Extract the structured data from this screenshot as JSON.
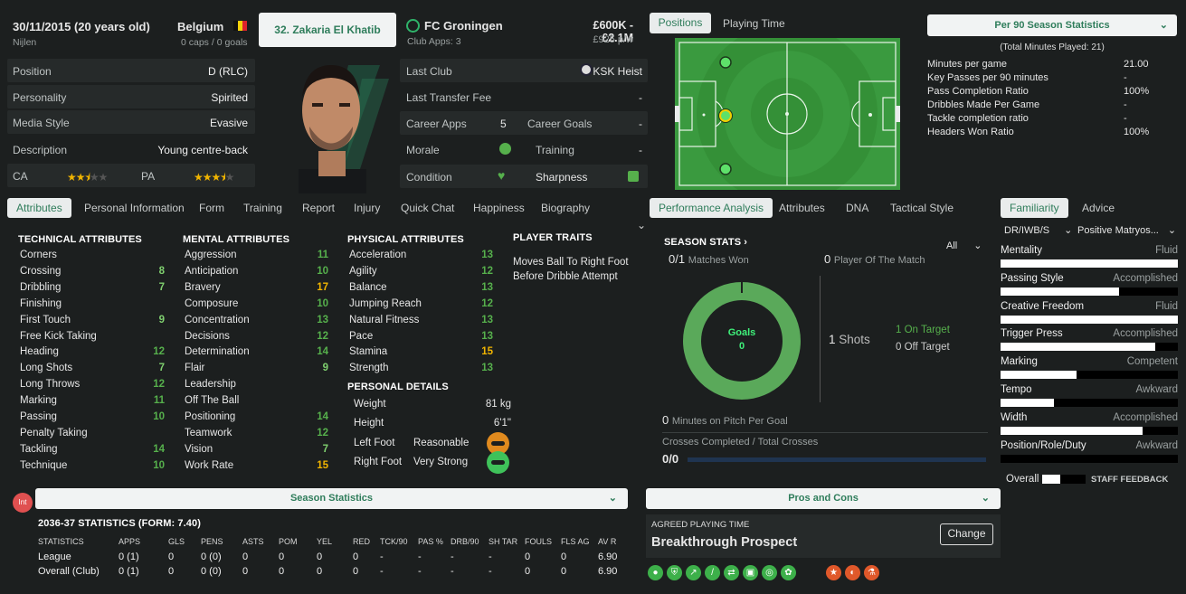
{
  "header": {
    "dob": "30/11/2015 (20 years old)",
    "city": "Nijlen",
    "nation": "Belgium",
    "caps": "0 caps / 0 goals",
    "player_button": "32. Zakaria El Khatib",
    "club": "FC Groningen",
    "club_apps": "Club Apps: 3",
    "value": "£600K - £2.1M",
    "wage": "£925 p/w"
  },
  "info": [
    {
      "label": "Position",
      "value": "D (RLC)"
    },
    {
      "label": "Personality",
      "value": "Spirited"
    },
    {
      "label": "Media Style",
      "value": "Evasive"
    },
    {
      "label": "Description",
      "value": "Young centre-back"
    }
  ],
  "ability": {
    "ca_label": "CA",
    "pa_label": "PA",
    "ca_stars": 2.5,
    "pa_stars": 3.5
  },
  "club_info": {
    "last_club_label": "Last Club",
    "last_club": "KSK Heist",
    "last_fee_label": "Last Transfer Fee",
    "last_fee": "-",
    "career_apps_label": "Career Apps",
    "career_apps": "5",
    "career_goals_label": "Career Goals",
    "career_goals": "-",
    "morale_label": "Morale",
    "training_label": "Training",
    "training": "-",
    "condition_label": "Condition",
    "sharpness_label": "Sharpness"
  },
  "right_tabs": {
    "positions": "Positions",
    "playing_time": "Playing Time"
  },
  "per90": {
    "dropdown": "Per 90 Season Statistics",
    "total": "(Total Minutes Played: 21)",
    "rows": [
      {
        "label": "Minutes per game",
        "value": "21.00"
      },
      {
        "label": "Key Passes per 90 minutes",
        "value": "-"
      },
      {
        "label": "Pass Completion Ratio",
        "value": "100%"
      },
      {
        "label": "Dribbles Made Per Game",
        "value": "-"
      },
      {
        "label": "Tackle completion ratio",
        "value": "-"
      },
      {
        "label": "Headers Won Ratio",
        "value": "100%"
      }
    ]
  },
  "tabs": [
    "Attributes",
    "Personal Information",
    "Form",
    "Training",
    "Report",
    "Injury",
    "Quick Chat",
    "Happiness",
    "Biography"
  ],
  "perf_tabs": [
    "Performance Analysis",
    "Attributes",
    "DNA",
    "Tactical Style"
  ],
  "fam_tabs": [
    "Familiarity",
    "Advice"
  ],
  "technical": {
    "title": "TECHNICAL ATTRIBUTES",
    "items": [
      {
        "n": "Corners",
        "v": ""
      },
      {
        "n": "Crossing",
        "v": "8"
      },
      {
        "n": "Dribbling",
        "v": "7"
      },
      {
        "n": "Finishing",
        "v": ""
      },
      {
        "n": "First Touch",
        "v": "9"
      },
      {
        "n": "Free Kick Taking",
        "v": ""
      },
      {
        "n": "Heading",
        "v": "12"
      },
      {
        "n": "Long Shots",
        "v": "7"
      },
      {
        "n": "Long Throws",
        "v": "12"
      },
      {
        "n": "Marking",
        "v": "11"
      },
      {
        "n": "Passing",
        "v": "10"
      },
      {
        "n": "Penalty Taking",
        "v": ""
      },
      {
        "n": "Tackling",
        "v": "14"
      },
      {
        "n": "Technique",
        "v": "10"
      }
    ]
  },
  "mental": {
    "title": "MENTAL ATTRIBUTES",
    "items": [
      {
        "n": "Aggression",
        "v": "11"
      },
      {
        "n": "Anticipation",
        "v": "10"
      },
      {
        "n": "Bravery",
        "v": "17"
      },
      {
        "n": "Composure",
        "v": "10"
      },
      {
        "n": "Concentration",
        "v": "13"
      },
      {
        "n": "Decisions",
        "v": "12"
      },
      {
        "n": "Determination",
        "v": "14"
      },
      {
        "n": "Flair",
        "v": "9"
      },
      {
        "n": "Leadership",
        "v": ""
      },
      {
        "n": "Off The Ball",
        "v": ""
      },
      {
        "n": "Positioning",
        "v": "14"
      },
      {
        "n": "Teamwork",
        "v": "12"
      },
      {
        "n": "Vision",
        "v": "7"
      },
      {
        "n": "Work Rate",
        "v": "15"
      }
    ]
  },
  "physical": {
    "title": "PHYSICAL ATTRIBUTES",
    "items": [
      {
        "n": "Acceleration",
        "v": "13"
      },
      {
        "n": "Agility",
        "v": "12"
      },
      {
        "n": "Balance",
        "v": "13"
      },
      {
        "n": "Jumping Reach",
        "v": "12"
      },
      {
        "n": "Natural Fitness",
        "v": "13"
      },
      {
        "n": "Pace",
        "v": "13"
      },
      {
        "n": "Stamina",
        "v": "15"
      },
      {
        "n": "Strength",
        "v": "13"
      }
    ]
  },
  "traits": {
    "title": "PLAYER TRAITS",
    "text1": "Moves Ball To Right Foot",
    "text2": "Before Dribble Attempt"
  },
  "personal": {
    "title": "PERSONAL DETAILS",
    "weight_label": "Weight",
    "weight": "81 kg",
    "height_label": "Height",
    "height": "6'1\"",
    "left_label": "Left Foot",
    "left": "Reasonable",
    "right_label": "Right Foot",
    "right": "Very Strong"
  },
  "season_stats": {
    "title": "SEASON STATS",
    "filter": "All",
    "matches_won": "0",
    "matches_total": "/1",
    "matches_label": "Matches Won",
    "potm": "0",
    "potm_label": "Player Of The Match",
    "goals_label": "Goals",
    "goals": "0",
    "shots": "1",
    "shots_label": "Shots",
    "on_target": "1",
    "on_target_label": "On Target",
    "off_target": "0",
    "off_target_label": "Off Target",
    "mins_per_goal": "0",
    "mins_label": "Minutes on Pitch Per Goal",
    "crosses_label": "Crosses Completed / Total Crosses",
    "crosses": "0/0"
  },
  "familiarity": {
    "role": "DR/IWB/S",
    "mentality_sel": "Positive Matryos...",
    "rows": [
      {
        "label": "Mentality",
        "level": "Fluid",
        "fill": 1.0
      },
      {
        "label": "Passing Style",
        "level": "Accomplished",
        "fill": 0.67
      },
      {
        "label": "Creative Freedom",
        "level": "Fluid",
        "fill": 1.0
      },
      {
        "label": "Trigger Press",
        "level": "Accomplished",
        "fill": 0.87
      },
      {
        "label": "Marking",
        "level": "Competent",
        "fill": 0.43
      },
      {
        "label": "Tempo",
        "level": "Awkward",
        "fill": 0.3
      },
      {
        "label": "Width",
        "level": "Accomplished",
        "fill": 0.8
      },
      {
        "label": "Position/Role/Duty",
        "level": "Awkward",
        "fill": 0
      }
    ],
    "overall": "Overall",
    "staff": "STAFF FEEDBACK"
  },
  "bottom": {
    "badge": "Int",
    "season_btn": "Season Statistics",
    "pros_btn": "Pros and Cons",
    "stats_title": "2036-37 STATISTICS (FORM: 7.40)",
    "agreed_label": "AGREED PLAYING TIME",
    "agreed": "Breakthrough Prospect",
    "change": "Change"
  },
  "stats_table": {
    "headers": [
      "STATISTICS",
      "APPS",
      "GLS",
      "PENS",
      "ASTS",
      "POM",
      "YEL",
      "RED",
      "TCK/90",
      "PAS %",
      "DRB/90",
      "SH TAR",
      "FOULS",
      "FLS AG",
      "AV R"
    ],
    "rows": [
      [
        "League",
        "0 (1)",
        "0",
        "0 (0)",
        "0",
        "0",
        "0",
        "0",
        "-",
        "-",
        "-",
        "-",
        "0",
        "0",
        "6.90"
      ],
      [
        "Overall (Club)",
        "0 (1)",
        "0",
        "0 (0)",
        "0",
        "0",
        "0",
        "0",
        "-",
        "-",
        "-",
        "-",
        "0",
        "0",
        "6.90"
      ]
    ]
  },
  "colors": {
    "accent": "#2f7d5b",
    "green": "#56b04c",
    "yellow": "#f0b400",
    "pitch": "#3a9a3f"
  }
}
